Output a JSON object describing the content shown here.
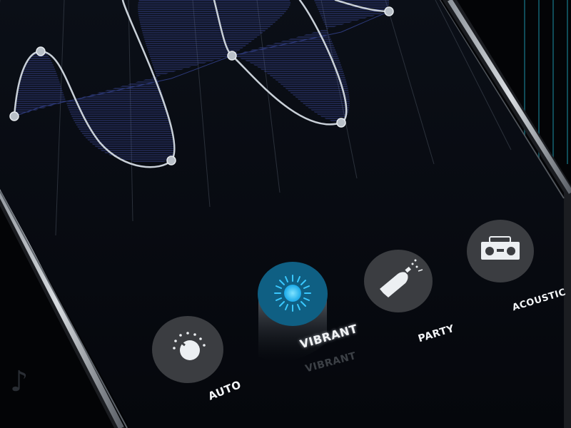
{
  "equalizer": {
    "curve_color": "#c9d0d8",
    "fill_color": "#3a4aa8",
    "grid_color": "#2b313b"
  },
  "modes": [
    {
      "id": "auto",
      "label": "AUTO",
      "icon": "knob-icon",
      "selected": false
    },
    {
      "id": "vibrant",
      "label": "VIBRANT",
      "icon": "sun-icon",
      "selected": true
    },
    {
      "id": "party",
      "label": "PARTY",
      "icon": "champagne-icon",
      "selected": false
    },
    {
      "id": "acoustic",
      "label": "ACOUSTIC",
      "icon": "boombox-icon",
      "selected": false
    }
  ],
  "colors": {
    "background": "#05070b",
    "button": "#3b3d41",
    "selected_button": "#0f5f83",
    "selected_glow": "#33c7ff",
    "icon": "#e9ecef"
  },
  "decor": {
    "music_note": "music-note-icon"
  }
}
